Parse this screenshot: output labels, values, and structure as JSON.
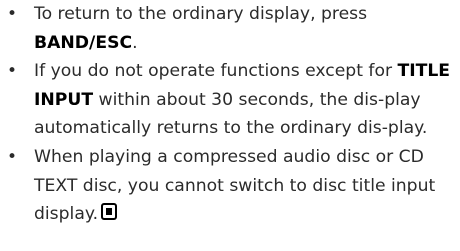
{
  "bullets": [
    {
      "marker": "•",
      "text_before": "To return to the ordinary display, press ",
      "bold": "BAND/ESC",
      "text_after": "."
    },
    {
      "marker": "•",
      "text_before": "If you do not operate functions except for ",
      "bold": "TITLE INPUT",
      "text_after": " within about 30 seconds, the dis-play automatically returns to the ordinary dis-play."
    },
    {
      "marker": "•",
      "text_before": "When playing a compressed audio disc or CD TEXT disc, you cannot switch to disc title input display.",
      "end_icon": "end-of-section-mark-icon"
    }
  ]
}
